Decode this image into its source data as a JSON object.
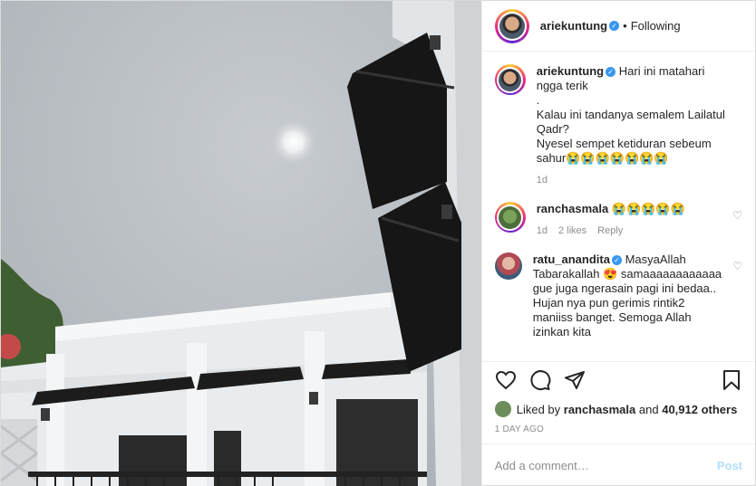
{
  "header": {
    "username": "ariekuntung",
    "separator": "•",
    "follow_status": "Following"
  },
  "caption": {
    "username": "ariekuntung",
    "text": "Hari ini matahari ngga terik\n.\nKalau ini tandanya semalem Lailatul Qadr?\nNyesel sempet ketiduran sebeum sahur😭😭😭😭😭😭😭",
    "age": "1d"
  },
  "comments": [
    {
      "username": "ranchasmala",
      "text": "😭😭😭😭😭",
      "age": "1d",
      "likes": "2 likes",
      "reply": "Reply"
    },
    {
      "username": "ratu_anandita",
      "text": "MasyaAllah Tabarakallah 😍 samaaaaaaaaaaaa gue juga ngerasain pagi ini bedaa.. Hujan nya pun gerimis rintik2 maniiss banget. Semoga Allah izinkan kita"
    }
  ],
  "likes": {
    "prefix": "Liked by",
    "by_user": "ranchasmala",
    "and": "and",
    "others": "40,912 others"
  },
  "timestamp": "1 DAY AGO",
  "add_comment": {
    "placeholder": "Add a comment…",
    "post_label": "Post"
  },
  "icons": {
    "like": "heart-icon",
    "comment": "comment-icon",
    "share": "paper-plane-icon",
    "save": "bookmark-icon",
    "verified": "verified-badge-icon"
  },
  "colors": {
    "verified": "#3897f0",
    "post_button_disabled": "#b2dffc",
    "meta_text": "#8e8e8e"
  }
}
